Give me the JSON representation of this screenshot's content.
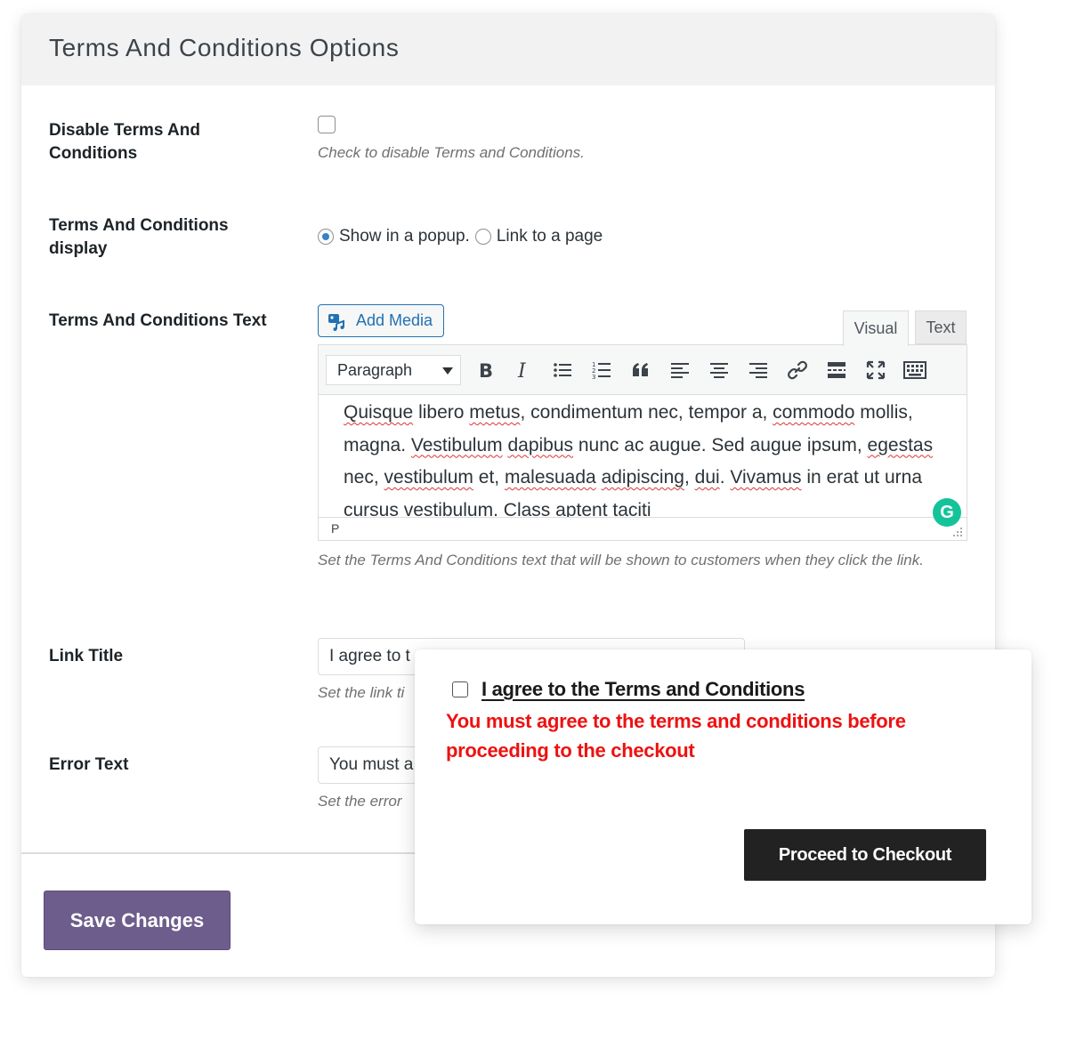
{
  "panel": {
    "title": "Terms And Conditions Options"
  },
  "disable": {
    "label": "Disable Terms And Conditions",
    "description": "Check to disable Terms and Conditions.",
    "checked": false
  },
  "display": {
    "label": "Terms And Conditions display",
    "options": [
      {
        "label": "Show in a popup.",
        "selected": true
      },
      {
        "label": "Link to a page",
        "selected": false
      }
    ]
  },
  "text_field": {
    "label": "Terms And Conditions Text",
    "add_media_label": "Add Media",
    "tabs": {
      "visual": "Visual",
      "text": "Text",
      "active": "Visual"
    },
    "format_select": "Paragraph",
    "toolbar_icons": [
      "bold-icon",
      "italic-icon",
      "bullet-list-icon",
      "numbered-list-icon",
      "blockquote-icon",
      "align-left-icon",
      "align-center-icon",
      "align-right-icon",
      "link-icon",
      "read-more-icon",
      "fullscreen-icon",
      "toolbar-toggle-icon"
    ],
    "content": "Quisque libero metus, condimentum nec, tempor a, commodo mollis, magna. Vestibulum dapibus nunc ac augue. Sed augue ipsum, egestas nec, vestibulum et, malesuada adipiscing, dui. Vivamus in erat ut urna cursus vestibulum. Class aptent taciti",
    "status_path": "P",
    "grammarly_badge": "G",
    "description": "Set the Terms And Conditions text that will be shown to customers when they click the link."
  },
  "link_title": {
    "label": "Link Title",
    "value": "I agree to t",
    "description": "Set the link ti"
  },
  "error_text": {
    "label": "Error Text",
    "value": "You must a",
    "description": "Set the error"
  },
  "save_button": "Save Changes",
  "preview": {
    "checkbox_label": "I agree to the Terms and Conditions",
    "error": "You must agree to the terms and conditions before proceeding to the checkout",
    "checkout_button": "Proceed to Checkout"
  },
  "colors": {
    "accent_blue": "#2271b1",
    "save_button": "#6d5d8c",
    "error_red": "#ee1111",
    "checkout_button": "#222222",
    "grammarly": "#15c39a"
  }
}
